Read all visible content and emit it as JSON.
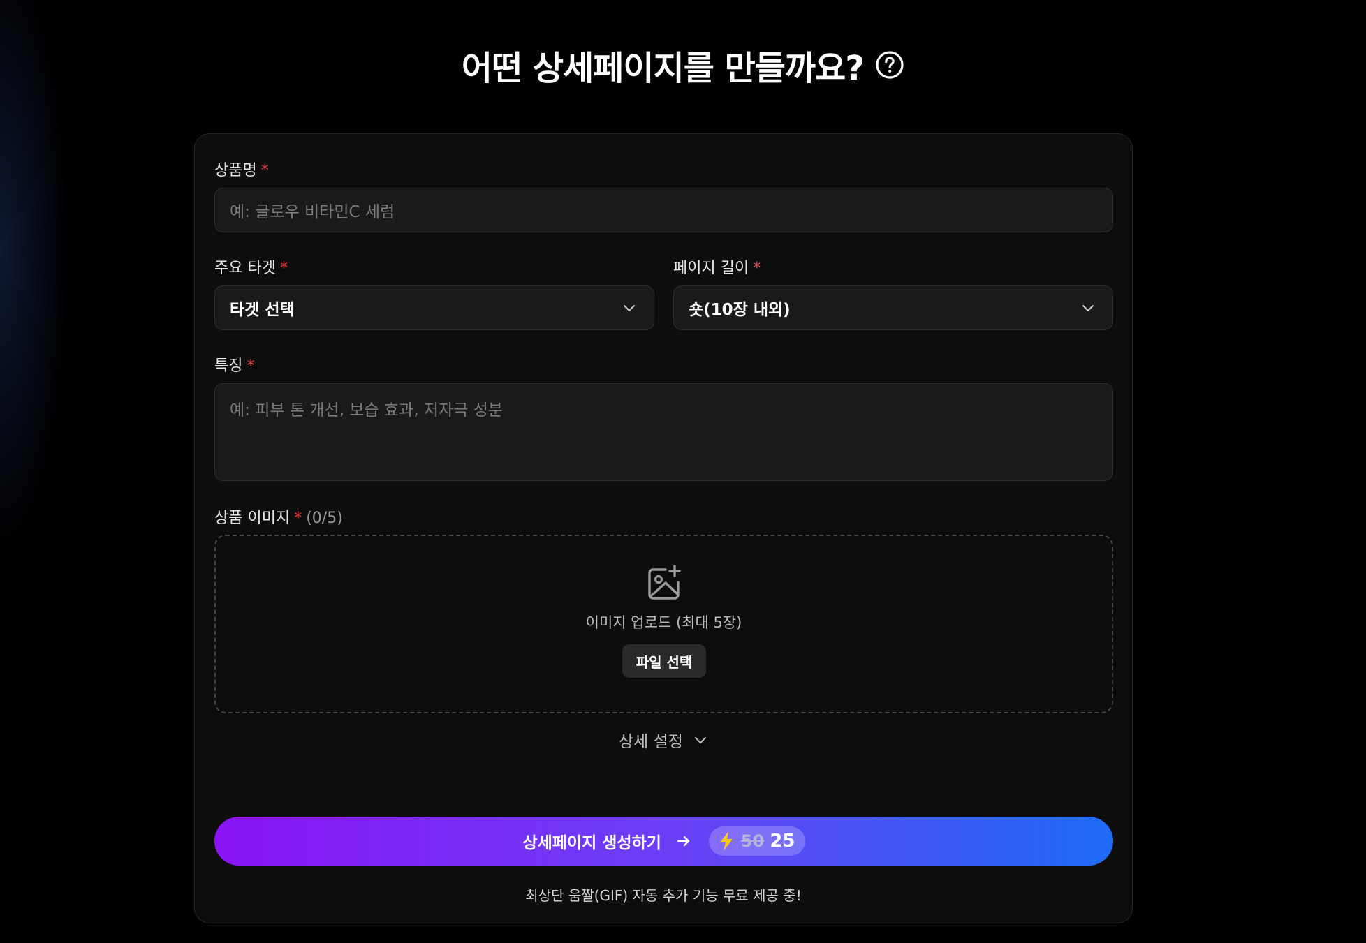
{
  "header": {
    "title": "어떤 상세페이지를 만들까요?",
    "help_icon": "question-circle-icon"
  },
  "form": {
    "product_name": {
      "label": "상품명",
      "required_mark": "*",
      "placeholder": "예: 글로우 비타민C 세럼",
      "value": ""
    },
    "target": {
      "label": "주요 타겟",
      "required_mark": "*",
      "selected": "타겟 선택"
    },
    "page_length": {
      "label": "페이지 길이",
      "required_mark": "*",
      "selected": "숏(10장 내외)"
    },
    "features": {
      "label": "특징",
      "required_mark": "*",
      "placeholder": "예: 피부 톤 개선, 보습 효과, 저자극 성분",
      "value": ""
    },
    "images": {
      "label": "상품 이미지",
      "required_mark": "*",
      "count": "(0/5)",
      "upload_text": "이미지 업로드 (최대 5장)",
      "file_button": "파일 선택",
      "icon": "image-plus-icon"
    },
    "advanced": {
      "label": "상세 설정"
    },
    "submit": {
      "label": "상세페이지 생성하기",
      "old_price": "50",
      "new_price": "25"
    },
    "promo_text": "최상단 움짤(GIF) 자동 추가 기능 무료 제공 중!"
  },
  "colors": {
    "background": "#000000",
    "card": "#0d0d0d",
    "field": "#1a1a1a",
    "required": "#ef4444",
    "gradient_start": "#8a14f5",
    "gradient_end": "#1e6bf7",
    "bolt": "#facc15"
  }
}
